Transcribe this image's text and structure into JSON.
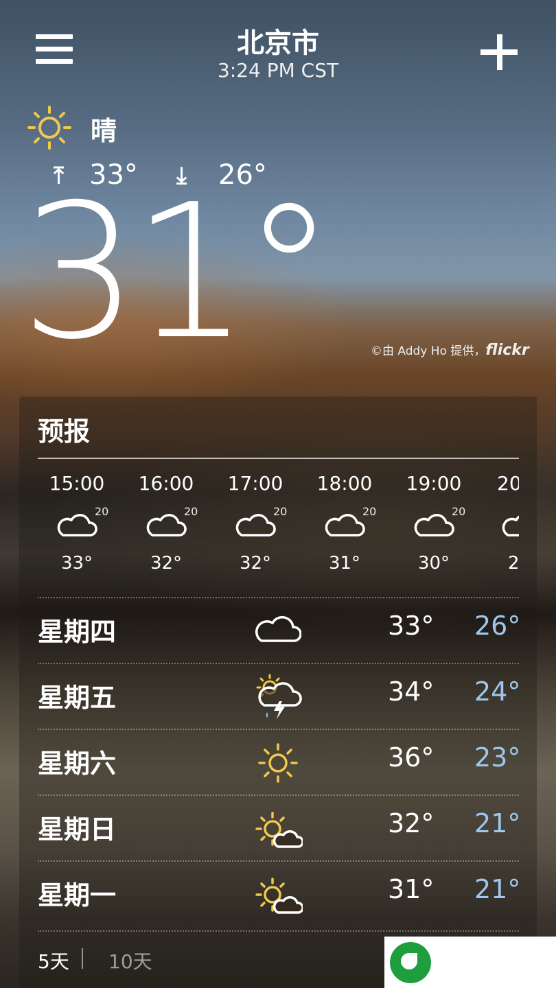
{
  "header": {
    "city": "北京市",
    "time": "3:24 PM CST"
  },
  "current": {
    "condition": "晴",
    "condition_icon": "sun-icon",
    "high": "33°",
    "low": "26°",
    "temperature": "31°"
  },
  "photo_credit": {
    "text": "©由 Addy Ho 提供，",
    "brand": "flickr"
  },
  "forecast": {
    "title": "预报",
    "hourly": [
      {
        "time": "15:00",
        "precip": "20",
        "icon": "cloud-icon",
        "temp": "33°"
      },
      {
        "time": "16:00",
        "precip": "20",
        "icon": "cloud-icon",
        "temp": "32°"
      },
      {
        "time": "17:00",
        "precip": "20",
        "icon": "cloud-icon",
        "temp": "32°"
      },
      {
        "time": "18:00",
        "precip": "20",
        "icon": "cloud-icon",
        "temp": "31°"
      },
      {
        "time": "19:00",
        "precip": "20",
        "icon": "cloud-icon",
        "temp": "30°"
      },
      {
        "time": "20",
        "precip": "",
        "icon": "cloud-icon",
        "temp": "2"
      }
    ],
    "daily": [
      {
        "day": "星期四",
        "icon": "cloud-icon",
        "high": "33°",
        "low": "26°"
      },
      {
        "day": "星期五",
        "icon": "thunderstorm-icon",
        "high": "34°",
        "low": "24°"
      },
      {
        "day": "星期六",
        "icon": "sun-icon",
        "high": "36°",
        "low": "23°"
      },
      {
        "day": "星期日",
        "icon": "partly-cloudy-icon",
        "high": "32°",
        "low": "21°"
      },
      {
        "day": "星期一",
        "icon": "partly-cloudy-icon",
        "high": "31°",
        "low": "21°"
      }
    ],
    "tabs": {
      "five_day": "5天",
      "ten_day": "10天"
    }
  },
  "colors": {
    "sun": "#f2c94c",
    "low_temp": "#9fc6ee",
    "badge_green": "#1e9e3c"
  }
}
